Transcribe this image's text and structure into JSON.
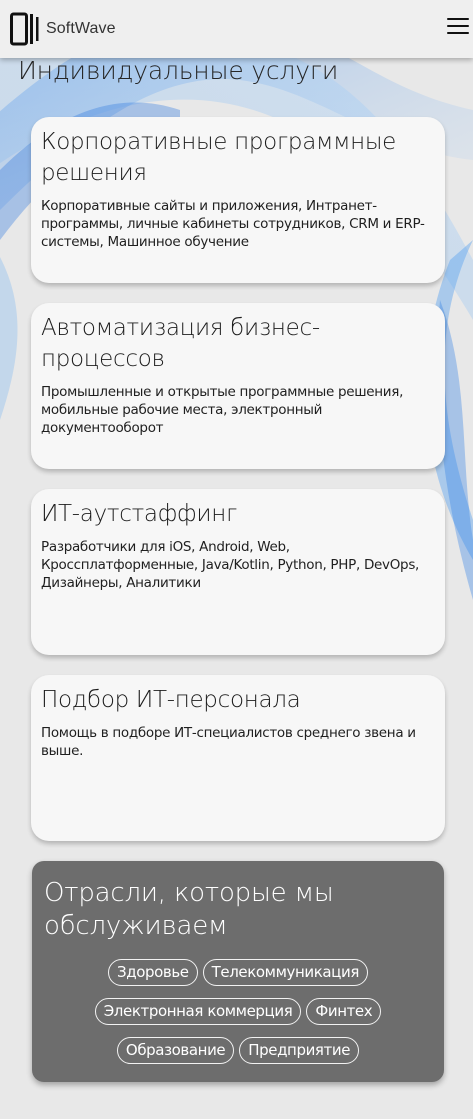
{
  "header": {
    "logo_text": "SoftWave",
    "logo_icon": "softwave-logo-mark",
    "menu_icon": "hamburger-menu-icon"
  },
  "section": {
    "title": "Индивидуальные услуги"
  },
  "cards": [
    {
      "title": "Корпоративные программные решения",
      "description": "Корпоративные сайты и приложения, Интранет-программы, личные кабинеты сотрудников, CRM и ERP-системы, Машинное обучение"
    },
    {
      "title": "Автоматизация бизнес-процессов",
      "description": "Промышленные и открытые программные решения, мобильные рабочие места, электронный документооборот"
    },
    {
      "title": "ИТ-аутстаффинг",
      "description": "Разработчики для iOS, Android, Web, Кроссплатформенные, Java/Kotlin, Python, PHP, DevOps, Дизайнеры, Аналитики"
    },
    {
      "title": "Подбор ИТ-персонала",
      "description": "Помощь в подборе ИТ-специалистов среднего звена и выше."
    }
  ],
  "industries": {
    "title": "Отрасли, которые мы обслуживаем",
    "tags": [
      "Здоровье",
      "Телекоммуникация",
      "Электронная коммерция",
      "Финтех",
      "Образование",
      "Предприятие"
    ]
  },
  "colors": {
    "background": "#e8e8e8",
    "card": "#f7f7f7",
    "industries_panel": "#6d6d6d",
    "wave_accent": "#3f8fe8"
  }
}
